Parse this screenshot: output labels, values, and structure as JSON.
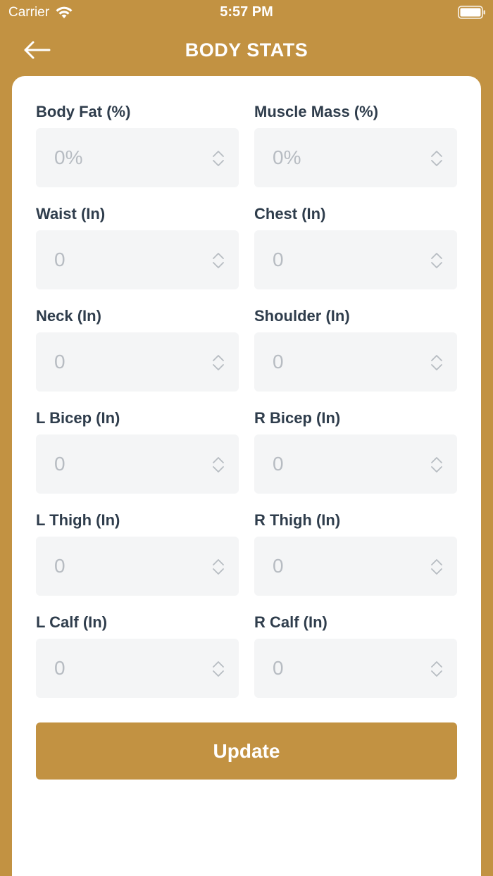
{
  "status": {
    "carrier": "Carrier",
    "time": "5:57 PM"
  },
  "header": {
    "title": "BODY STATS",
    "back_icon": "arrow-left-icon"
  },
  "colors": {
    "accent": "#C29242",
    "label": "#2f3d4c",
    "input_bg": "#f4f5f6",
    "placeholder": "#b7bcc2"
  },
  "fields": {
    "body_fat": {
      "label": "Body Fat (%)",
      "placeholder": "0%"
    },
    "muscle_mass": {
      "label": "Muscle Mass (%)",
      "placeholder": "0%"
    },
    "waist": {
      "label": "Waist (In)",
      "placeholder": "0"
    },
    "chest": {
      "label": "Chest (In)",
      "placeholder": "0"
    },
    "neck": {
      "label": "Neck (In)",
      "placeholder": "0"
    },
    "shoulder": {
      "label": "Shoulder (In)",
      "placeholder": "0"
    },
    "l_bicep": {
      "label": "L Bicep (In)",
      "placeholder": "0"
    },
    "r_bicep": {
      "label": "R Bicep (In)",
      "placeholder": "0"
    },
    "l_thigh": {
      "label": "L Thigh (In)",
      "placeholder": "0"
    },
    "r_thigh": {
      "label": "R Thigh (In)",
      "placeholder": "0"
    },
    "l_calf": {
      "label": "L Calf (In)",
      "placeholder": "0"
    },
    "r_calf": {
      "label": "R Calf (In)",
      "placeholder": "0"
    }
  },
  "actions": {
    "update_label": "Update"
  }
}
